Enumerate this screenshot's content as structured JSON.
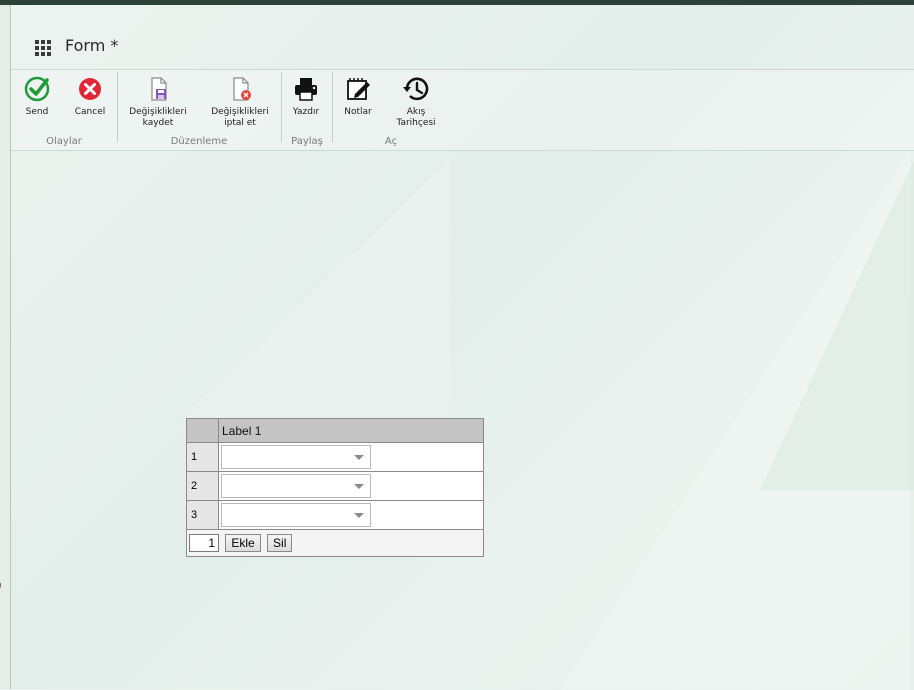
{
  "header": {
    "title": "Form *"
  },
  "ribbon": {
    "groups": [
      {
        "label": "Olaylar"
      },
      {
        "label": "Düzenleme"
      },
      {
        "label": "Paylaş"
      },
      {
        "label": "Aç"
      }
    ],
    "buttons": {
      "send": {
        "label": "Send",
        "icon": "check-circle-icon",
        "color": "#1e9b37"
      },
      "cancel": {
        "label": "Cancel",
        "icon": "x-circle-icon",
        "color": "#e32636"
      },
      "save": {
        "label_line1": "Değişiklikleri",
        "label_line2": "kaydet",
        "icon": "save-file-icon"
      },
      "discard": {
        "label_line1": "Değişiklikleri",
        "label_line2": "iptal et",
        "icon": "discard-file-icon"
      },
      "print": {
        "label": "Yazdır",
        "icon": "printer-icon"
      },
      "notes": {
        "label": "Notlar",
        "icon": "notes-icon"
      },
      "history": {
        "label_line1": "Akış",
        "label_line2": "Tarihçesi",
        "icon": "history-icon"
      }
    }
  },
  "grid": {
    "header_label": "Label 1",
    "rows": [
      {
        "num": "1",
        "value": ""
      },
      {
        "num": "2",
        "value": ""
      },
      {
        "num": "3",
        "value": ""
      }
    ],
    "footer": {
      "count": "1",
      "add_label": "Ekle",
      "remove_label": "Sil"
    }
  }
}
